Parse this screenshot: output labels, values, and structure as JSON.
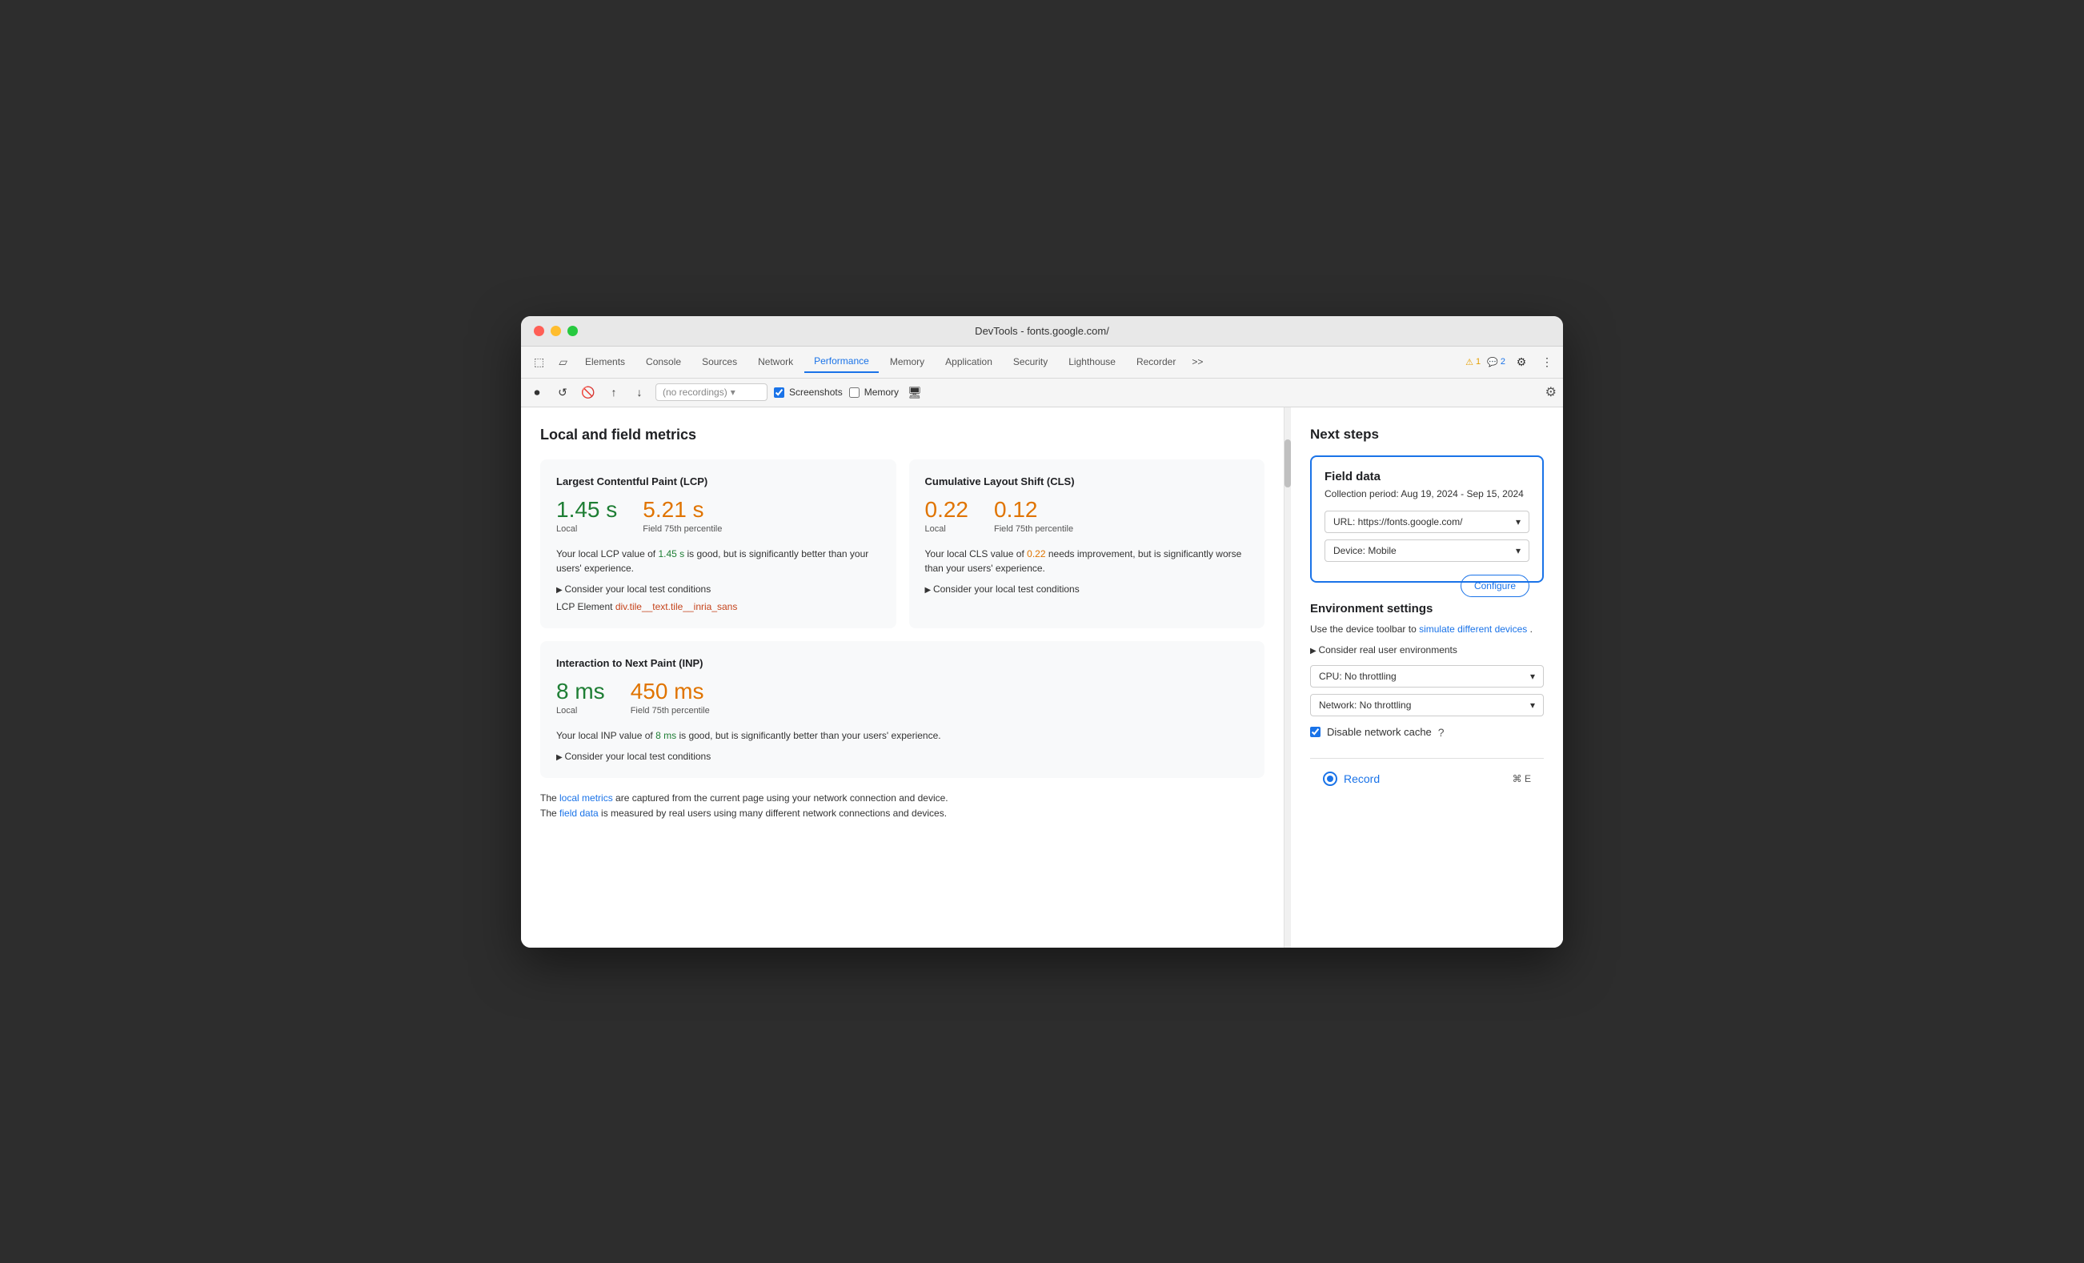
{
  "window": {
    "title": "DevTools - fonts.google.com/"
  },
  "traffic_lights": {
    "close": "close",
    "minimize": "minimize",
    "maximize": "maximize"
  },
  "toolbar": {
    "tabs": [
      {
        "label": "Elements",
        "active": false
      },
      {
        "label": "Console",
        "active": false
      },
      {
        "label": "Sources",
        "active": false
      },
      {
        "label": "Network",
        "active": false
      },
      {
        "label": "Performance",
        "active": true
      },
      {
        "label": "Memory",
        "active": false
      },
      {
        "label": "Application",
        "active": false
      },
      {
        "label": "Security",
        "active": false
      },
      {
        "label": "Lighthouse",
        "active": false
      },
      {
        "label": "Recorder",
        "active": false
      }
    ],
    "more_label": ">>",
    "warn_count": "1",
    "info_count": "2"
  },
  "secondary_toolbar": {
    "recording_placeholder": "(no recordings)",
    "screenshots_label": "Screenshots",
    "screenshots_checked": true,
    "memory_label": "Memory",
    "memory_checked": false
  },
  "main": {
    "section_title": "Local and field metrics",
    "lcp": {
      "title": "Largest Contentful Paint (LCP)",
      "local_value": "1.45 s",
      "field_value": "5.21 s",
      "local_label": "Local",
      "field_label": "Field 75th percentile",
      "description_before": "Your local LCP value of",
      "description_highlight": "1.45 s",
      "description_after": "is good, but is significantly better than your users' experience.",
      "consider_link": "Consider your local test conditions",
      "lcp_element_label": "LCP Element",
      "lcp_element_value": "div.tile__text.tile__inria_sans"
    },
    "cls": {
      "title": "Cumulative Layout Shift (CLS)",
      "local_value": "0.22",
      "field_value": "0.12",
      "local_label": "Local",
      "field_label": "Field 75th percentile",
      "description_before": "Your local CLS value of",
      "description_highlight": "0.22",
      "description_after": "needs improvement, but is significantly worse than your users' experience.",
      "consider_link": "Consider your local test conditions"
    },
    "inp": {
      "title": "Interaction to Next Paint (INP)",
      "local_value": "8 ms",
      "field_value": "450 ms",
      "local_label": "Local",
      "field_label": "Field 75th percentile",
      "description_before": "Your local INP value of",
      "description_highlight": "8 ms",
      "description_after": "is good, but is significantly better than your users' experience.",
      "consider_link": "Consider your local test conditions"
    },
    "bottom_note_1": "The local metrics are captured from the current page using your network connection and device.",
    "bottom_note_2": "The field data is measured by real users using many different network connections and devices.",
    "local_metrics_link": "local metrics",
    "field_data_link": "field data"
  },
  "sidebar": {
    "title": "Next steps",
    "field_data": {
      "title": "Field data",
      "period": "Collection period: Aug 19, 2024 - Sep 15, 2024",
      "url_label": "URL: https://fonts.google.com/",
      "device_label": "Device: Mobile",
      "configure_label": "Configure"
    },
    "env_settings": {
      "title": "Environment settings",
      "description_before": "Use the device toolbar to",
      "description_link": "simulate different devices",
      "description_after": ".",
      "consider_link": "Consider real user environments",
      "cpu_label": "CPU: No throttling",
      "network_label": "Network: No throttling",
      "disable_cache_label": "Disable network cache"
    },
    "record": {
      "label": "Record",
      "shortcut": "⌘ E"
    }
  }
}
